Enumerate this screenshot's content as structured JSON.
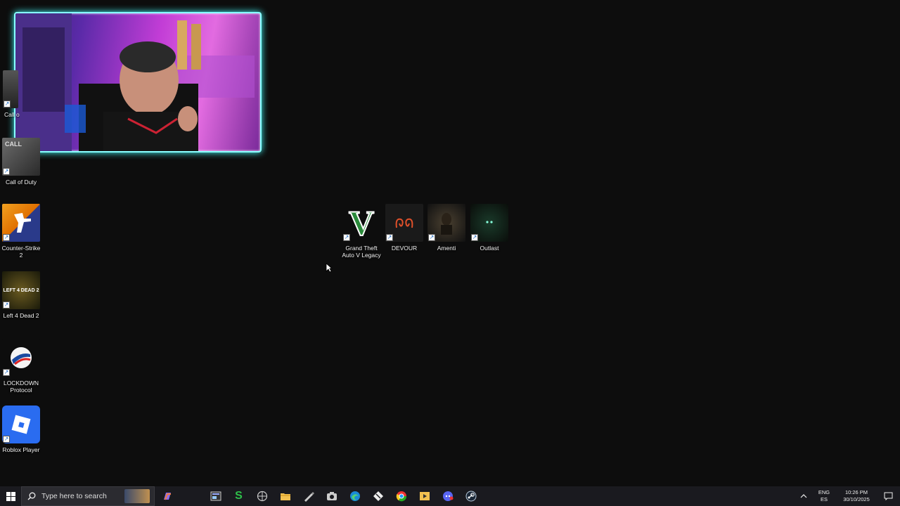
{
  "desktop": {
    "left_icons": [
      {
        "name": "call-of-duty-uncut-shortcut",
        "label": "Call of Duty Un..."
      },
      {
        "name": "call-of-duty-shortcut",
        "label": "Call of Duty"
      },
      {
        "name": "counter-strike-2-shortcut",
        "label": "Counter-Strike 2"
      },
      {
        "name": "left-4-dead-2-shortcut",
        "label": "Left 4 Dead 2"
      },
      {
        "name": "lockdown-protocol-shortcut",
        "label": "LOCKDOWN Protocol"
      },
      {
        "name": "roblox-player-shortcut",
        "label": "Roblox Player"
      }
    ],
    "center_icons": [
      {
        "name": "gta-v-shortcut",
        "label": "Grand Theft Auto V Legacy"
      },
      {
        "name": "devour-shortcut",
        "label": "DEVOUR"
      },
      {
        "name": "amenti-shortcut",
        "label": "Amenti"
      },
      {
        "name": "outlast-shortcut",
        "label": "Outlast"
      }
    ],
    "art_text": {
      "gta": "V",
      "l4d": "LEFT 4 DEAD 2"
    }
  },
  "taskbar": {
    "search_placeholder": "Type here to search",
    "language_top": "ENG",
    "language_bottom": "ES",
    "time": "10:26 PM",
    "date": "30/10/2025",
    "apps": [
      "copilot-icon",
      "task-view-icon",
      "s-app-icon",
      "browser-icon",
      "file-explorer-icon",
      "pen-tool-icon",
      "camera-app-icon",
      "edge-icon",
      "git-icon",
      "chrome-icon",
      "media-app-icon",
      "discord-icon",
      "steam-icon"
    ]
  },
  "colors": {
    "desktop_bg": "#0d0d0d",
    "taskbar_bg": "#1a1a1f",
    "webcam_border": "#88ffff"
  }
}
